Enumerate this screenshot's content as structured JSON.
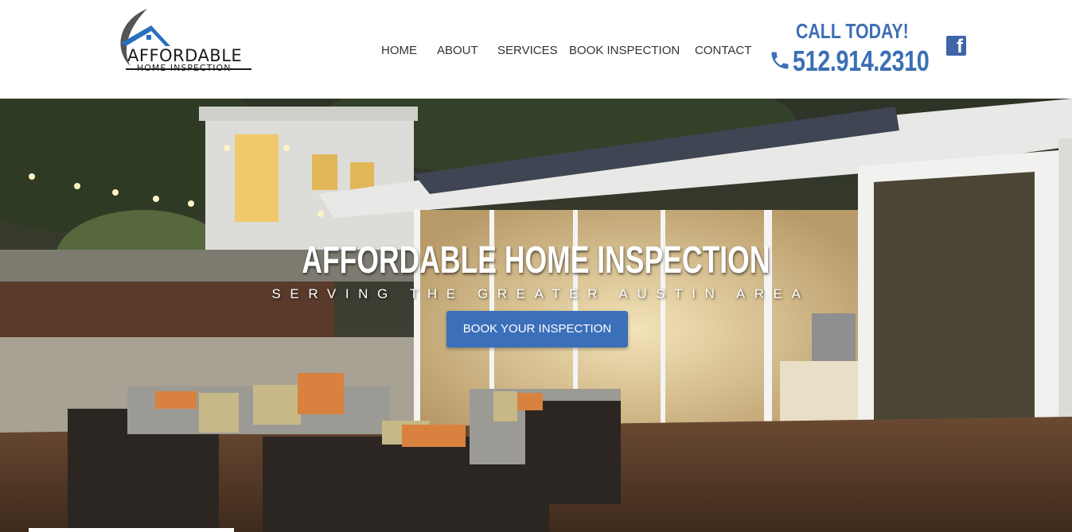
{
  "header": {
    "logo": {
      "line1": "AFFORDABLE",
      "line2": "HOME  INSPECTION"
    },
    "nav": [
      {
        "label": "HOME"
      },
      {
        "label": "ABOUT"
      },
      {
        "label": "SERVICES"
      },
      {
        "label": "BOOK INSPECTION"
      },
      {
        "label": "CONTACT"
      }
    ],
    "call_label": "CALL TODAY!",
    "phone": "512.914.2310",
    "social_icon": "facebook-icon"
  },
  "hero": {
    "title": "AFFORDABLE HOME INSPECTION",
    "subtitle": "SERVING THE GREATER AUSTIN AREA",
    "button": "BOOK YOUR INSPECTION"
  },
  "colors": {
    "accent": "#3c6fb5",
    "button": "#3b6fba",
    "nav_text": "#333333"
  }
}
